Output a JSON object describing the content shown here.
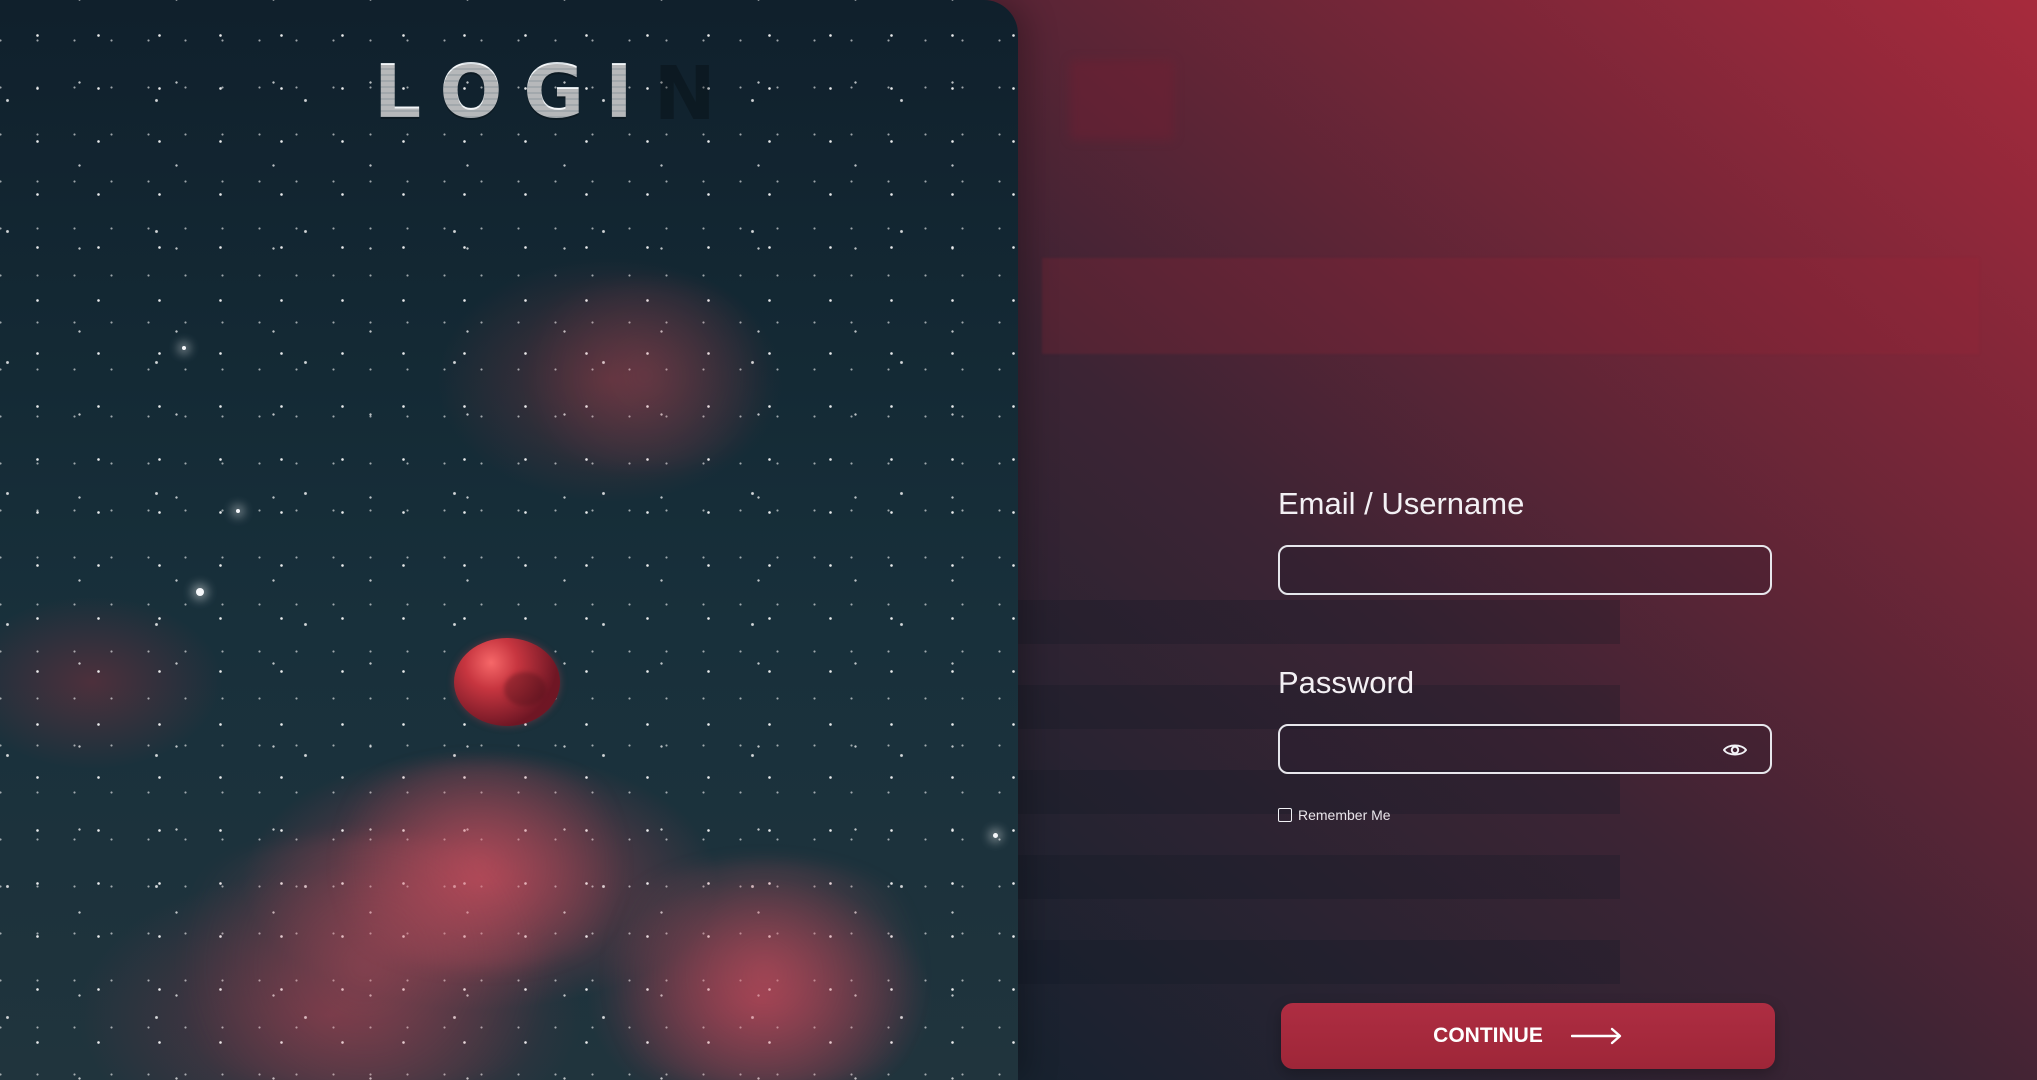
{
  "left": {
    "title": "LOGIN"
  },
  "form": {
    "email": {
      "label": "Email / Username",
      "value": "",
      "placeholder": ""
    },
    "password": {
      "label": "Password",
      "value": "",
      "placeholder": "",
      "toggle_icon": "eye-icon"
    },
    "remember": {
      "label": "Remember Me",
      "checked": false
    },
    "continue_button": {
      "label": "CONTINUE",
      "icon": "arrow-right-icon"
    }
  },
  "colors": {
    "accent": "#a52a3c",
    "field_border": "#e7e7ec",
    "text": "#f3f0f4",
    "left_panel_dark": "#10202c"
  }
}
